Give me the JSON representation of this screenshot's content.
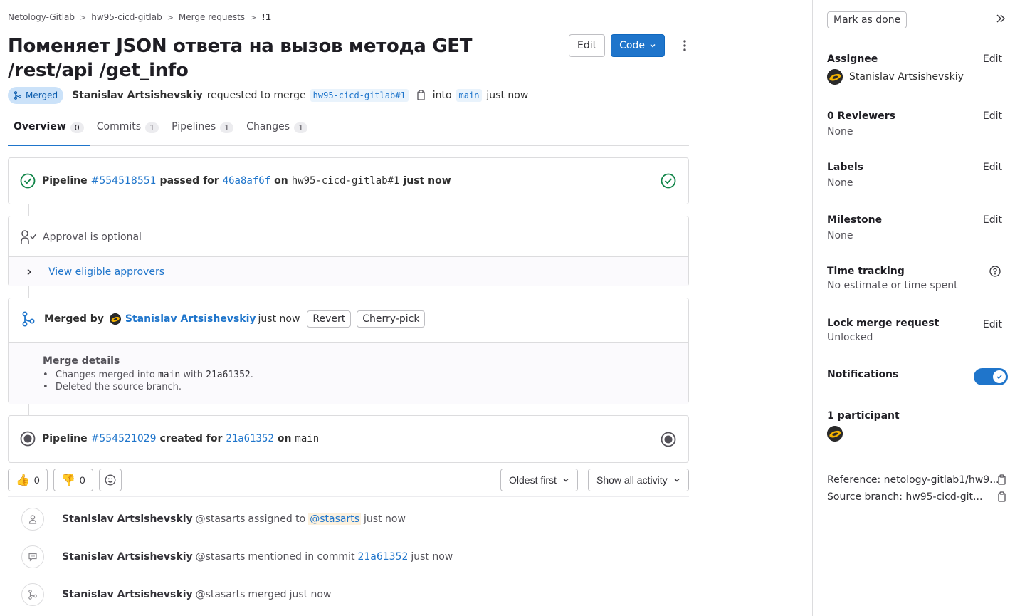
{
  "breadcrumb": {
    "items": [
      "Netology-Gitlab",
      "hw95-cicd-gitlab",
      "Merge requests"
    ],
    "current": "!1"
  },
  "title": "Поменяет JSON ответа на вызов метода GET /rest/api /get_info",
  "header": {
    "edit_label": "Edit",
    "code_label": "Code"
  },
  "meta": {
    "status": "Merged",
    "author": "Stanislav Artsishevskiy",
    "requested_text": "requested to merge",
    "source_branch": "hw95-cicd-gitlab#1",
    "into_text": "into",
    "target_branch": "main",
    "time": "just now"
  },
  "tabs": [
    {
      "label": "Overview",
      "count": "0"
    },
    {
      "label": "Commits",
      "count": "1"
    },
    {
      "label": "Pipelines",
      "count": "1"
    },
    {
      "label": "Changes",
      "count": "1"
    }
  ],
  "pipeline1": {
    "label": "Pipeline",
    "id": "#554518551",
    "status_text": "passed for",
    "commit": "46a8af6f",
    "on_text": "on",
    "branch": "hw95-cicd-gitlab#1",
    "time": "just now",
    "status_color": "#108548"
  },
  "approval": {
    "text": "Approval is optional",
    "approvers_link": "View eligible approvers"
  },
  "merged": {
    "label": "Merged by",
    "user": "Stanislav Artsishevskiy",
    "time": "just now",
    "revert_label": "Revert",
    "cherry_label": "Cherry-pick",
    "details_title": "Merge details",
    "detail1_prefix": "Changes merged into",
    "detail1_branch": "main",
    "detail1_with": "with",
    "detail1_commit": "21a61352",
    "detail1_end": ".",
    "detail2": "Deleted the source branch."
  },
  "pipeline2": {
    "label": "Pipeline",
    "id": "#554521029",
    "status_text": "created for",
    "commit": "21a61352",
    "on_text": "on",
    "branch": "main"
  },
  "reactions": {
    "thumbs_up_count": "0",
    "thumbs_down_count": "0"
  },
  "sort": {
    "order_label": "Oldest first",
    "filter_label": "Show all activity"
  },
  "activity": [
    {
      "icon": "user-icon",
      "user": "Stanislav Artsishevskiy",
      "handle": "@stasarts",
      "action": "assigned to",
      "target": "@stasarts",
      "time": "just now"
    },
    {
      "icon": "comment-icon",
      "user": "Stanislav Artsishevskiy",
      "handle": "@stasarts",
      "action": "mentioned in commit",
      "target": "21a61352",
      "time": "just now"
    },
    {
      "icon": "merge-icon",
      "user": "Stanislav Artsishevskiy",
      "handle": "@stasarts",
      "action": "merged",
      "time": "just now"
    }
  ],
  "sidebar": {
    "mark_done": "Mark as done",
    "edit": "Edit",
    "assignee_title": "Assignee",
    "assignee_name": "Stanislav Artsishevskiy",
    "reviewers_title": "0 Reviewers",
    "reviewers_value": "None",
    "labels_title": "Labels",
    "labels_value": "None",
    "milestone_title": "Milestone",
    "milestone_value": "None",
    "time_title": "Time tracking",
    "time_value": "No estimate or time spent",
    "lock_title": "Lock merge request",
    "lock_value": "Unlocked",
    "notifications_title": "Notifications",
    "notifications_on": true,
    "participants_title": "1 participant",
    "reference": "Reference: netology-gitlab1/hw9...",
    "source_branch": "Source branch: hw95-cicd-git..."
  },
  "colors": {
    "accent": "#1f75cb",
    "success": "#108548",
    "merged_badge_bg": "#cbe2f9"
  }
}
